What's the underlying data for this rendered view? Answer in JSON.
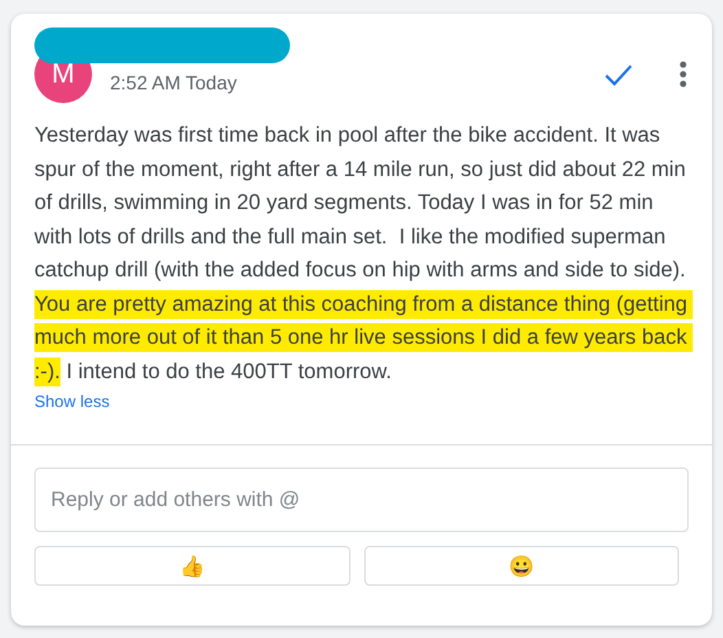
{
  "comment": {
    "avatar_letter": "M",
    "time": "2:52 AM Today",
    "resolved": true,
    "body": [
      {
        "text": "Yesterday was first time back in pool after the bike accident. It was spur of the moment, right after a 14 mile run, so just did about 22 min of drills, swimming in 20 yard segments. Today I was in for 52 min with lots of drills and the full main set.  I like the modified superman catchup drill (with the added focus on hip with arms and side to side).",
        "highlighted": false
      },
      {
        "text": "You are pretty amazing at this coaching from a distance thing (getting much more out of it than 5 one hr live sessions I did a few years back :-).",
        "highlighted": true
      },
      {
        "text": "I intend to do the 400TT tomorrow.",
        "highlighted": false
      }
    ],
    "toggle_link": "Show less"
  },
  "reply": {
    "placeholder": "Reply or add others with @"
  },
  "reactions": [
    {
      "emoji": "👍"
    },
    {
      "emoji": "😀"
    }
  ]
}
